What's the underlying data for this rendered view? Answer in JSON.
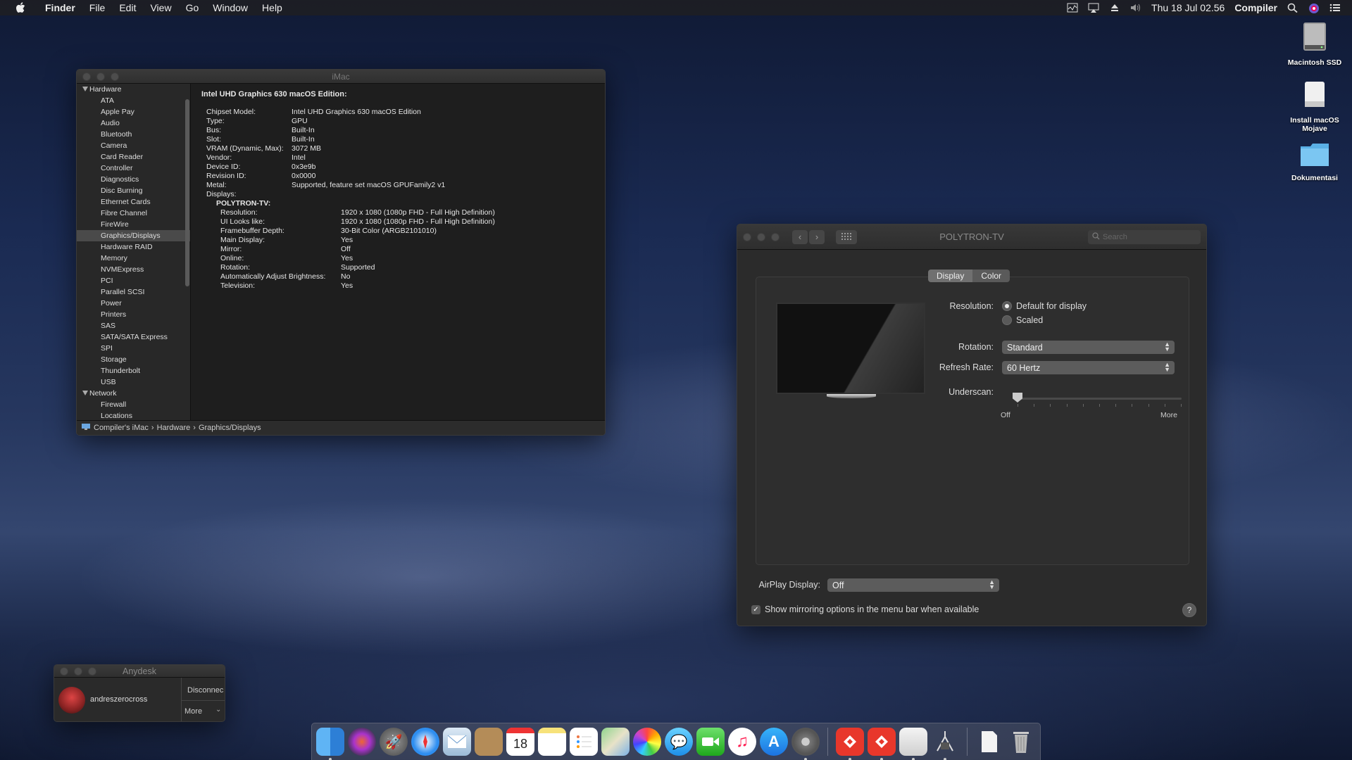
{
  "menubar": {
    "app_name": "Finder",
    "menus": [
      "File",
      "Edit",
      "View",
      "Go",
      "Window",
      "Help"
    ],
    "clock": "Thu 18 Jul  02.56",
    "user": "Compiler"
  },
  "desktop": {
    "icons": [
      {
        "label": "Macintosh SSD"
      },
      {
        "label": "Install macOS Mojave"
      },
      {
        "label": "Dokumentasi"
      }
    ]
  },
  "sysinfo": {
    "title": "iMac",
    "sidebar": {
      "hardware_label": "Hardware",
      "hardware_items": [
        "ATA",
        "Apple Pay",
        "Audio",
        "Bluetooth",
        "Camera",
        "Card Reader",
        "Controller",
        "Diagnostics",
        "Disc Burning",
        "Ethernet Cards",
        "Fibre Channel",
        "FireWire",
        "Graphics/Displays",
        "Hardware RAID",
        "Memory",
        "NVMExpress",
        "PCI",
        "Parallel SCSI",
        "Power",
        "Printers",
        "SAS",
        "SATA/SATA Express",
        "SPI",
        "Storage",
        "Thunderbolt",
        "USB"
      ],
      "selected": "Graphics/Displays",
      "network_label": "Network",
      "network_items": [
        "Firewall",
        "Locations"
      ]
    },
    "detail": {
      "heading": "Intel UHD Graphics 630 macOS Edition:",
      "rows": [
        {
          "k": "Chipset Model:",
          "v": "Intel UHD Graphics 630 macOS Edition"
        },
        {
          "k": "Type:",
          "v": "GPU"
        },
        {
          "k": "Bus:",
          "v": "Built-In"
        },
        {
          "k": "Slot:",
          "v": "Built-In"
        },
        {
          "k": "VRAM (Dynamic, Max):",
          "v": "3072 MB"
        },
        {
          "k": "Vendor:",
          "v": "Intel"
        },
        {
          "k": "Device ID:",
          "v": "0x3e9b"
        },
        {
          "k": "Revision ID:",
          "v": "0x0000"
        },
        {
          "k": "Metal:",
          "v": "Supported, feature set macOS GPUFamily2 v1"
        },
        {
          "k": "Displays:",
          "v": ""
        }
      ],
      "display_name": "POLYTRON-TV:",
      "display_rows": [
        {
          "k": "Resolution:",
          "v": "1920 x 1080 (1080p FHD - Full High Definition)"
        },
        {
          "k": "UI Looks like:",
          "v": "1920 x 1080 (1080p FHD - Full High Definition)"
        },
        {
          "k": "Framebuffer Depth:",
          "v": "30-Bit Color (ARGB2101010)"
        },
        {
          "k": "Main Display:",
          "v": "Yes"
        },
        {
          "k": "Mirror:",
          "v": "Off"
        },
        {
          "k": "Online:",
          "v": "Yes"
        },
        {
          "k": "Rotation:",
          "v": "Supported"
        },
        {
          "k": "Automatically Adjust Brightness:",
          "v": "No"
        },
        {
          "k": "Television:",
          "v": "Yes"
        }
      ]
    },
    "breadcrumb": [
      "Compiler's iMac",
      "Hardware",
      "Graphics/Displays"
    ]
  },
  "display_prefs": {
    "title": "POLYTRON-TV",
    "search_placeholder": "Search",
    "tabs": [
      "Display",
      "Color"
    ],
    "resolution_label": "Resolution:",
    "resolution_options": [
      "Default for display",
      "Scaled"
    ],
    "rotation_label": "Rotation:",
    "rotation_value": "Standard",
    "refresh_label": "Refresh Rate:",
    "refresh_value": "60 Hertz",
    "underscan_label": "Underscan:",
    "underscan_min": "Off",
    "underscan_max": "More",
    "underscan_level": 0,
    "airplay_label": "AirPlay Display:",
    "airplay_value": "Off",
    "mirroring_checkbox": "Show mirroring options in the menu bar when available",
    "help": "?"
  },
  "anydesk": {
    "title": "Anydesk",
    "user": "andreszerocross",
    "disconnect": "Disconnec",
    "more": "More"
  },
  "dock": {
    "calendar_day": "18"
  }
}
